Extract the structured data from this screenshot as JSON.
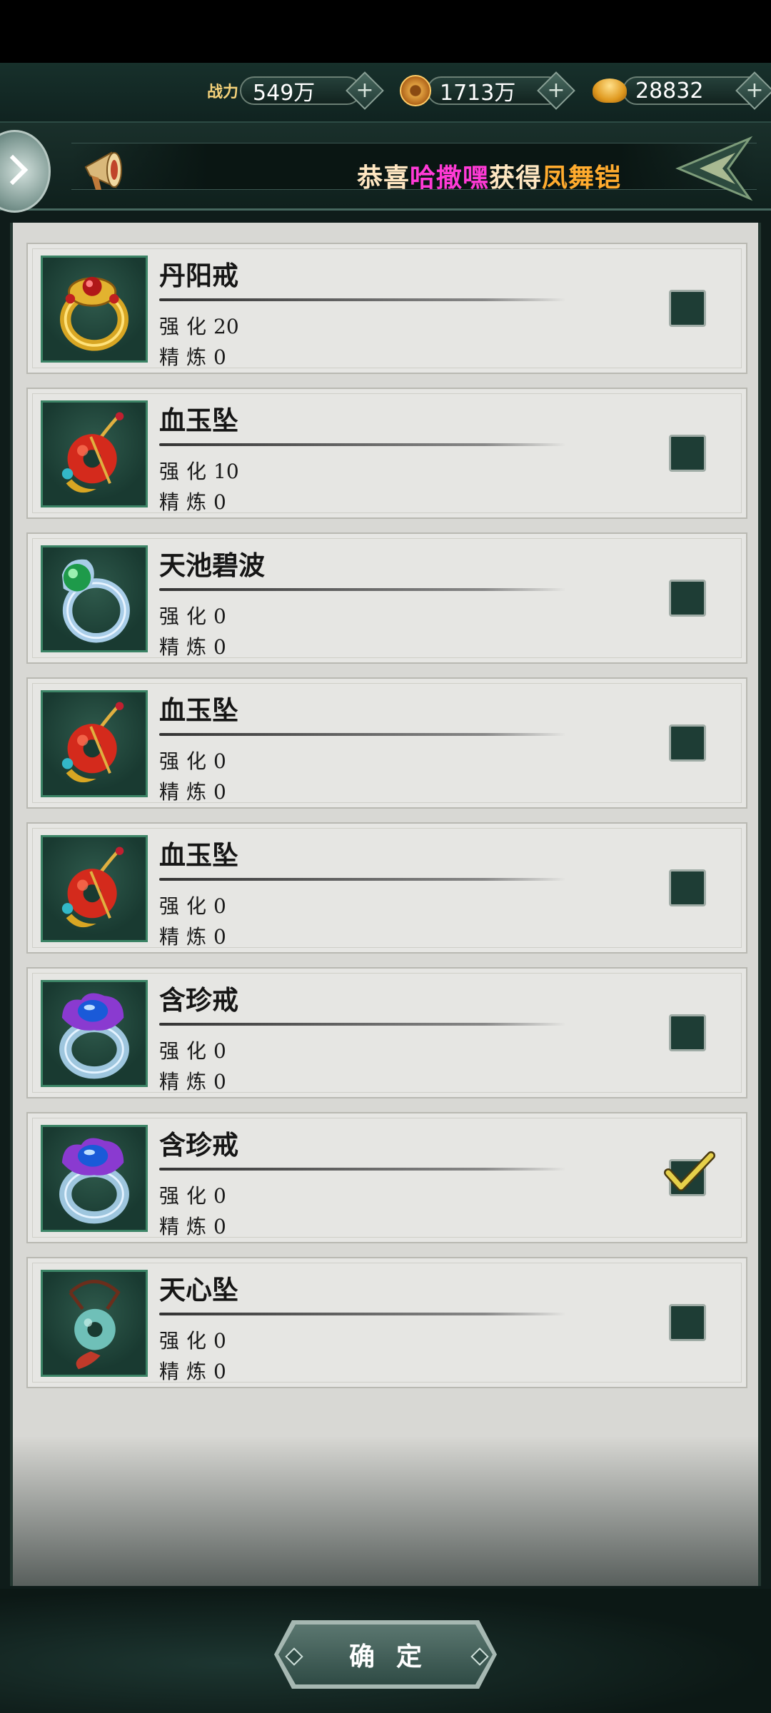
{
  "top_bar": {
    "power_label": "战力",
    "power_value": "549万",
    "copper_value": "1713万",
    "ingot_value": "28832"
  },
  "broadcast": {
    "prefix": "恭喜",
    "player": "哈撒嘿",
    "verb": "获得",
    "item": "凤舞铠"
  },
  "equipment": [
    {
      "name": "丹阳戒",
      "enhance_label": "强化",
      "enhance": "20",
      "refine_label": "精炼",
      "refine": "0",
      "checked": false,
      "icon": "gold-ring-icon"
    },
    {
      "name": "血玉坠",
      "enhance_label": "强化",
      "enhance": "10",
      "refine_label": "精炼",
      "refine": "0",
      "checked": false,
      "icon": "blood-jade-pendant-icon"
    },
    {
      "name": "天池碧波",
      "enhance_label": "强化",
      "enhance": "0",
      "refine_label": "精炼",
      "refine": "0",
      "checked": false,
      "icon": "jade-ring-icon"
    },
    {
      "name": "血玉坠",
      "enhance_label": "强化",
      "enhance": "0",
      "refine_label": "精炼",
      "refine": "0",
      "checked": false,
      "icon": "blood-jade-pendant-icon"
    },
    {
      "name": "血玉坠",
      "enhance_label": "强化",
      "enhance": "0",
      "refine_label": "精炼",
      "refine": "0",
      "checked": false,
      "icon": "blood-jade-pendant-icon"
    },
    {
      "name": "含珍戒",
      "enhance_label": "强化",
      "enhance": "0",
      "refine_label": "精炼",
      "refine": "0",
      "checked": false,
      "icon": "sapphire-ring-icon"
    },
    {
      "name": "含珍戒",
      "enhance_label": "强化",
      "enhance": "0",
      "refine_label": "精炼",
      "refine": "0",
      "checked": true,
      "icon": "sapphire-ring-icon"
    },
    {
      "name": "天心坠",
      "enhance_label": "强化",
      "enhance": "0",
      "refine_label": "精炼",
      "refine": "0",
      "checked": false,
      "icon": "jade-disc-pendant-icon"
    }
  ],
  "confirm_label": "确定"
}
